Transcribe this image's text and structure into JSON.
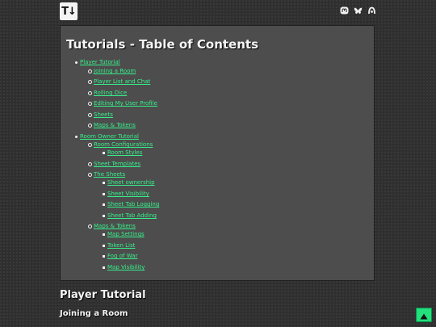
{
  "header": {
    "logo_text": "T↓",
    "social_icons": [
      "mastodon-icon",
      "bluesky-icon",
      "threads-icon"
    ]
  },
  "toc": {
    "title": "Tutorials - Table of Contents",
    "items": [
      {
        "label": "Player Tutorial",
        "level": 1
      },
      {
        "label": "Joining a Room",
        "level": 2
      },
      {
        "label": "Player List and Chat",
        "level": 2
      },
      {
        "label": "Rolling Dice",
        "level": 2
      },
      {
        "label": "Editing My User Profile",
        "level": 2
      },
      {
        "label": "Sheets",
        "level": 2
      },
      {
        "label": "Maps & Tokens",
        "level": 2
      },
      {
        "label": "Room Owner Tutorial",
        "level": 1
      },
      {
        "label": "Room Configurations",
        "level": 2
      },
      {
        "label": "Room Styles",
        "level": 3
      },
      {
        "label": "Sheet Templates",
        "level": 2
      },
      {
        "label": "The Sheets",
        "level": 2
      },
      {
        "label": "Sheet ownership",
        "level": 3
      },
      {
        "label": "Sheet Visibility",
        "level": 3
      },
      {
        "label": "Sheet Tab Logging",
        "level": 3
      },
      {
        "label": "Sheet Tab Adding",
        "level": 3
      },
      {
        "label": "Maps & Tokens",
        "level": 2
      },
      {
        "label": "Map Settings",
        "level": 3
      },
      {
        "label": "Token List",
        "level": 3
      },
      {
        "label": "Fog of War",
        "level": 3
      },
      {
        "label": "Map Visibility",
        "level": 3
      }
    ]
  },
  "content": {
    "section_heading": "Player Tutorial",
    "sub_heading": "Joining a Room"
  },
  "colors": {
    "link": "#35f08a",
    "background": "#2f2f2f",
    "panel": "#4d4d4d",
    "scroll_button": "#23e07c"
  },
  "scroll_top_icon": "arrow-up-icon"
}
